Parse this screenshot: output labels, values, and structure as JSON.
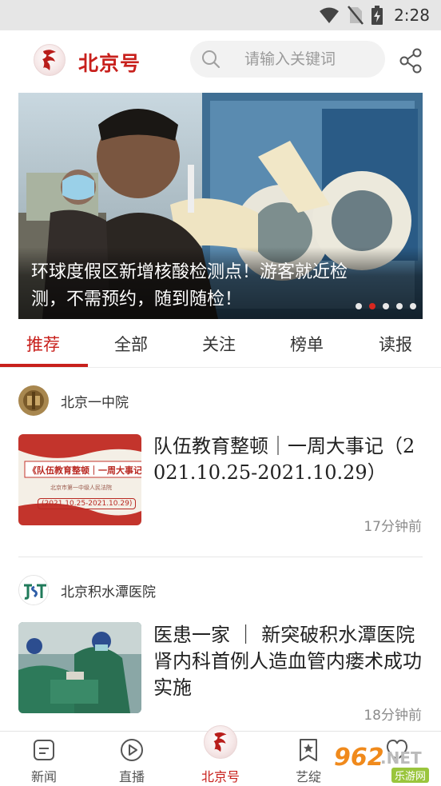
{
  "status_bar": {
    "time": "2:28",
    "icons": [
      "wifi-icon",
      "no-sim-icon",
      "battery-charging-icon"
    ]
  },
  "header": {
    "logo_char": "京",
    "brand": "北京号",
    "search_placeholder": "请输入关键词",
    "share_icon": "share-icon"
  },
  "banner": {
    "caption": "环球度假区新增核酸检测点！游客就近检测，不需预约，随到随检！",
    "dots": [
      false,
      true,
      false,
      false,
      false
    ]
  },
  "tabs": [
    {
      "label": "推荐",
      "active": true
    },
    {
      "label": "全部",
      "active": false
    },
    {
      "label": "关注",
      "active": false
    },
    {
      "label": "榜单",
      "active": false
    },
    {
      "label": "读报",
      "active": false
    }
  ],
  "feed": [
    {
      "source": "北京一中院",
      "title": "队伍教育整顿｜一周大事记（2021.10.25-2021.10.29）",
      "time": "17分钟前",
      "thumb": {
        "heading": "《队伍教育整顿｜一周大事记",
        "sub": "北京市第一中级人民法院",
        "dates": "(2021.10.25-2021.10.29)"
      }
    },
    {
      "source": "北京积水潭医院",
      "source_logo": "JST",
      "title": "医患一家 ｜ 新突破积水潭医院肾内科首例人造血管内瘘术成功实施",
      "time": "18分钟前"
    }
  ],
  "bottom_nav": [
    {
      "label": "新闻",
      "icon": "news-icon",
      "active": false
    },
    {
      "label": "直播",
      "icon": "play-icon",
      "active": false
    },
    {
      "label": "北京号",
      "icon": "beijing-logo-icon",
      "active": true
    },
    {
      "label": "艺绽",
      "icon": "bookmark-star-icon",
      "active": false
    },
    {
      "label": "",
      "icon": "heart-icon",
      "active": false
    }
  ],
  "watermark": {
    "brand": "962",
    "suffix": ".NET",
    "sub": "乐游网"
  },
  "colors": {
    "accent": "#c8201c",
    "dot_active": "#d8271f",
    "muted": "#8c8c8c"
  }
}
